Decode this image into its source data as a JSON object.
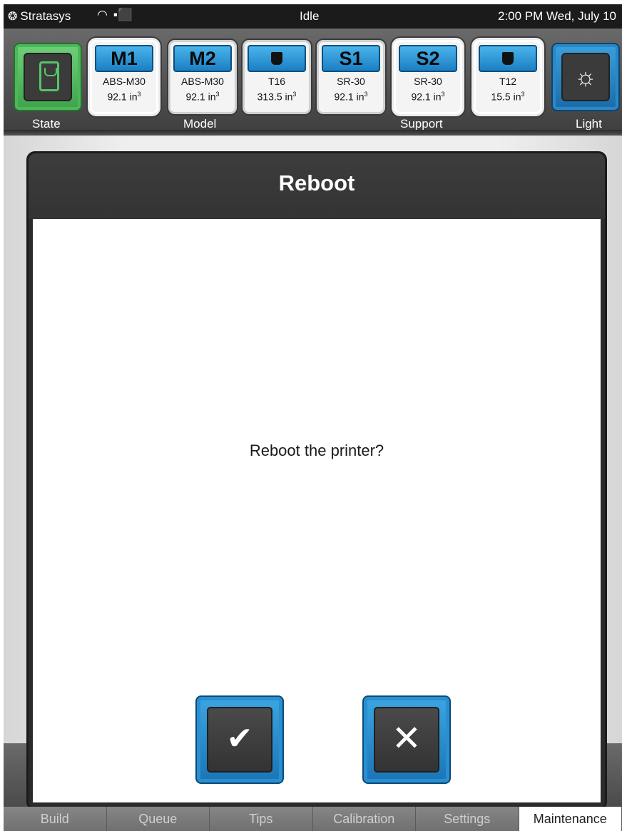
{
  "status_bar": {
    "brand": "Stratasys",
    "state": "Idle",
    "datetime": "2:00 PM Wed, July 10"
  },
  "header": {
    "state_label": "State",
    "model_label": "Model",
    "support_label": "Support",
    "light_label": "Light",
    "cartridges": [
      {
        "tag": "M1",
        "material": "ABS-M30",
        "volume": "92.1 in",
        "loaded": true
      },
      {
        "tag": "M2",
        "material": "ABS-M30",
        "volume": "92.1 in",
        "loaded": false
      },
      {
        "tag": "",
        "material": "T16",
        "volume": "313.5 in",
        "loaded": false
      },
      {
        "tag": "S1",
        "material": "SR-30",
        "volume": "92.1 in",
        "loaded": false
      },
      {
        "tag": "S2",
        "material": "SR-30",
        "volume": "92.1 in",
        "loaded": true
      },
      {
        "tag": "",
        "material": "T12",
        "volume": "15.5 in",
        "loaded": true
      }
    ],
    "volume_exponent": "3"
  },
  "dialog": {
    "title": "Reboot",
    "message": "Reboot the printer?",
    "confirm_icon": "check-icon",
    "cancel_icon": "close-icon"
  },
  "tabs": [
    {
      "label": "Build",
      "active": false
    },
    {
      "label": "Queue",
      "active": false
    },
    {
      "label": "Tips",
      "active": false
    },
    {
      "label": "Calibration",
      "active": false
    },
    {
      "label": "Settings",
      "active": false
    },
    {
      "label": "Maintenance",
      "active": true
    }
  ],
  "colors": {
    "accent_blue": "#1b7fc4",
    "state_green": "#3fa34a"
  }
}
